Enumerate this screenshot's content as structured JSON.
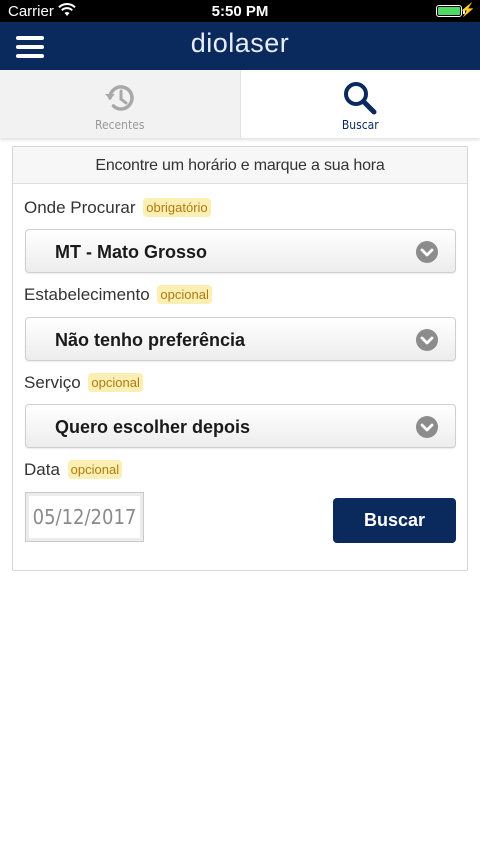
{
  "status_bar": {
    "carrier": "Carrier",
    "time": "5:50 PM",
    "battery_level": 1.0
  },
  "header": {
    "title": "diolaser",
    "menu_icon": "hamburger-menu-icon",
    "color": "#0a2a5e"
  },
  "tabs": [
    {
      "label": "Recentes",
      "icon": "history-icon",
      "active": false
    },
    {
      "label": "Buscar",
      "icon": "search-icon",
      "active": true
    }
  ],
  "form": {
    "heading": "Encontre um horário e marque a sua hora",
    "fields": [
      {
        "label": "Onde Procurar",
        "tag": "obrigatório",
        "value": "MT - Mato Grosso"
      },
      {
        "label": "Estabelecimento",
        "tag": "opcional",
        "value": "Não tenho preferência"
      },
      {
        "label": "Serviço",
        "tag": "opcional",
        "value": "Quero escolher depois"
      }
    ],
    "date": {
      "label": "Data",
      "tag": "opcional",
      "placeholder": "05/12/2017"
    },
    "submit_label": "Buscar"
  },
  "colors": {
    "brand": "#0a2a5e",
    "tag_bg": "#fcefb4",
    "tag_text": "#b07a12"
  }
}
